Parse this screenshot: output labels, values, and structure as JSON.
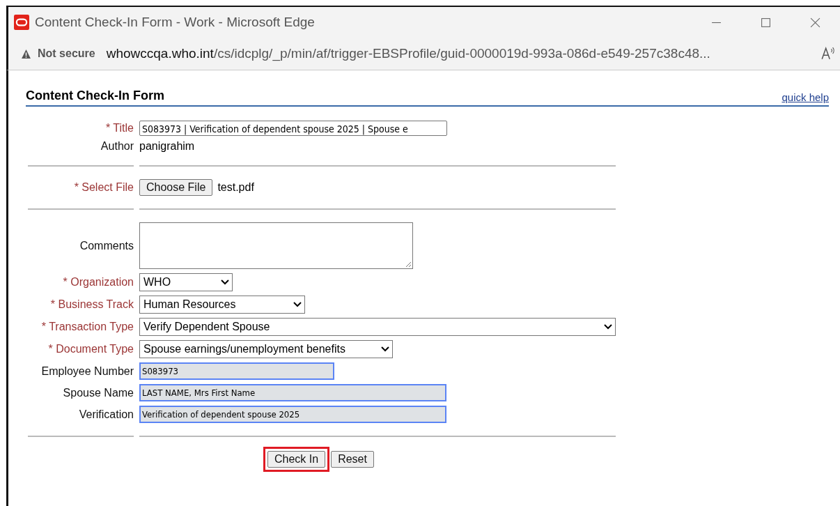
{
  "window": {
    "title": "Content Check-In Form - Work - Microsoft Edge"
  },
  "address_bar": {
    "security": "Not secure",
    "host": "whowccqa.who.int",
    "path": "/cs/idcplg/_p/min/af/trigger-EBSProfile/guid-0000019d-993a-086d-e549-257c38c48..."
  },
  "form": {
    "heading": "Content Check-In Form",
    "help_link": "quick help",
    "rows": [
      {
        "kind": "text",
        "label": "* Title",
        "required": true,
        "value": "S083973 | Verification of dependent spouse 2025 | Spouse e"
      },
      {
        "kind": "static",
        "label": "Author",
        "required": false,
        "value": "panigrahim"
      },
      {
        "kind": "separator"
      },
      {
        "kind": "file",
        "label": "* Select File",
        "required": true,
        "button": "Choose File",
        "value": "test.pdf"
      },
      {
        "kind": "separator"
      },
      {
        "kind": "textarea",
        "label": "Comments",
        "required": false
      },
      {
        "kind": "select",
        "label": "* Organization",
        "required": true,
        "value": "WHO"
      },
      {
        "kind": "select",
        "label": "* Business Track",
        "required": true,
        "value": "Human Resources"
      },
      {
        "kind": "select",
        "label": "* Transaction Type",
        "required": true,
        "value": "Verify Dependent Spouse"
      },
      {
        "kind": "select",
        "label": "* Document Type",
        "required": true,
        "value": "Spouse earnings/unemployment benefits"
      },
      {
        "kind": "readonly",
        "label": "Employee Number",
        "required": false,
        "value": "S083973"
      },
      {
        "kind": "readonly",
        "label": "Spouse Name",
        "required": false,
        "value": "LAST NAME, Mrs First Name"
      },
      {
        "kind": "readonly",
        "label": "Verification",
        "required": false,
        "value": "Verification of dependent spouse 2025"
      },
      {
        "kind": "separator"
      }
    ],
    "buttons": [
      {
        "label": "Check In",
        "highlighted": true
      },
      {
        "label": "Reset",
        "highlighted": false
      }
    ]
  }
}
